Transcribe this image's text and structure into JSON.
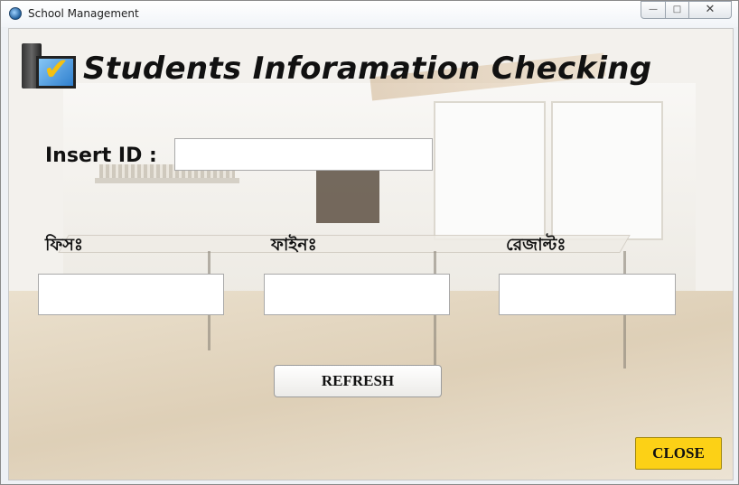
{
  "window": {
    "title": "School Management",
    "controls": {
      "minimize": "—",
      "maximize": "□",
      "close": "✕"
    }
  },
  "form": {
    "heading": "Students Inforamation Checking",
    "insert_id_label": "Insert ID :",
    "insert_id_value": "",
    "fees_label": "ফিসঃ",
    "fees_value": "",
    "fine_label": "ফাইনঃ",
    "fine_value": "",
    "result_label": "রেজাল্টঃ",
    "result_value": "",
    "refresh_label": "REFRESH",
    "close_label": "CLOSE"
  },
  "colors": {
    "close_button": "#fcd116",
    "logo_check": "#f4c010",
    "monitor": "#2f7fce"
  },
  "icons": {
    "app": "app-icon",
    "logo": "computer-check-logo"
  }
}
